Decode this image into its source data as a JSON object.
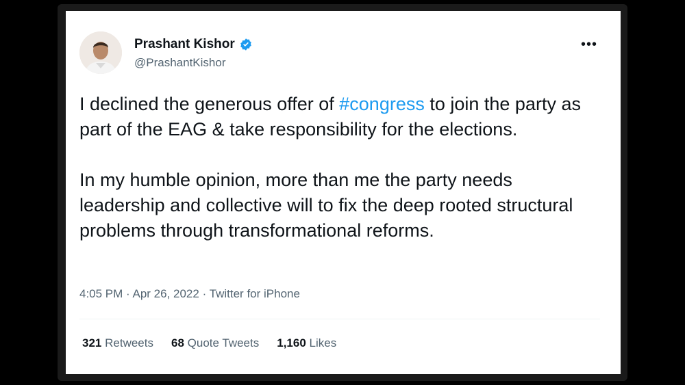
{
  "tweet": {
    "author_name": "Prashant Kishor",
    "handle": "@PrashantKishor",
    "more_label": "•••",
    "text_part1": "I declined the generous offer of ",
    "hashtag": "#congress",
    "text_part2": " to join the party as part of the EAG & take responsibility for the elections.",
    "paragraph2": "In my humble opinion, more than me the party needs leadership and collective will to fix the deep rooted structural problems through transformational reforms.",
    "time": "4:05 PM",
    "date": "Apr 26, 2022",
    "source": "Twitter for iPhone",
    "separator": " · "
  },
  "stats": {
    "retweets_count": "321",
    "retweets_label": "Retweets",
    "quotes_count": "68",
    "quotes_label": "Quote Tweets",
    "likes_count": "1,160",
    "likes_label": "Likes"
  },
  "colors": {
    "accent": "#1d9bf0",
    "text": "#0f1419",
    "muted": "#536471"
  },
  "icons": {
    "verified": "verified-badge-icon",
    "more": "more-options-icon"
  }
}
